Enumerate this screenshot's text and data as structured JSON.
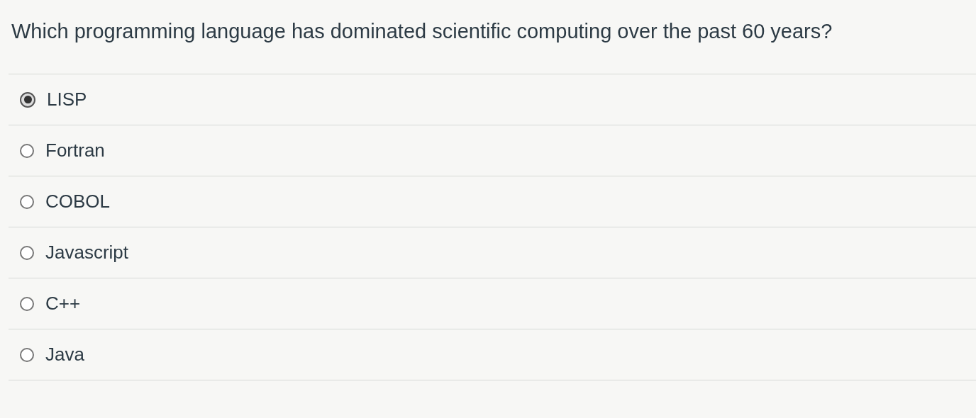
{
  "question": "Which programming language has dominated scientific computing over the past 60 years?",
  "options": [
    {
      "label": "LISP",
      "selected": true
    },
    {
      "label": "Fortran",
      "selected": false
    },
    {
      "label": "COBOL",
      "selected": false
    },
    {
      "label": "Javascript",
      "selected": false
    },
    {
      "label": "C++",
      "selected": false
    },
    {
      "label": "Java",
      "selected": false
    }
  ]
}
